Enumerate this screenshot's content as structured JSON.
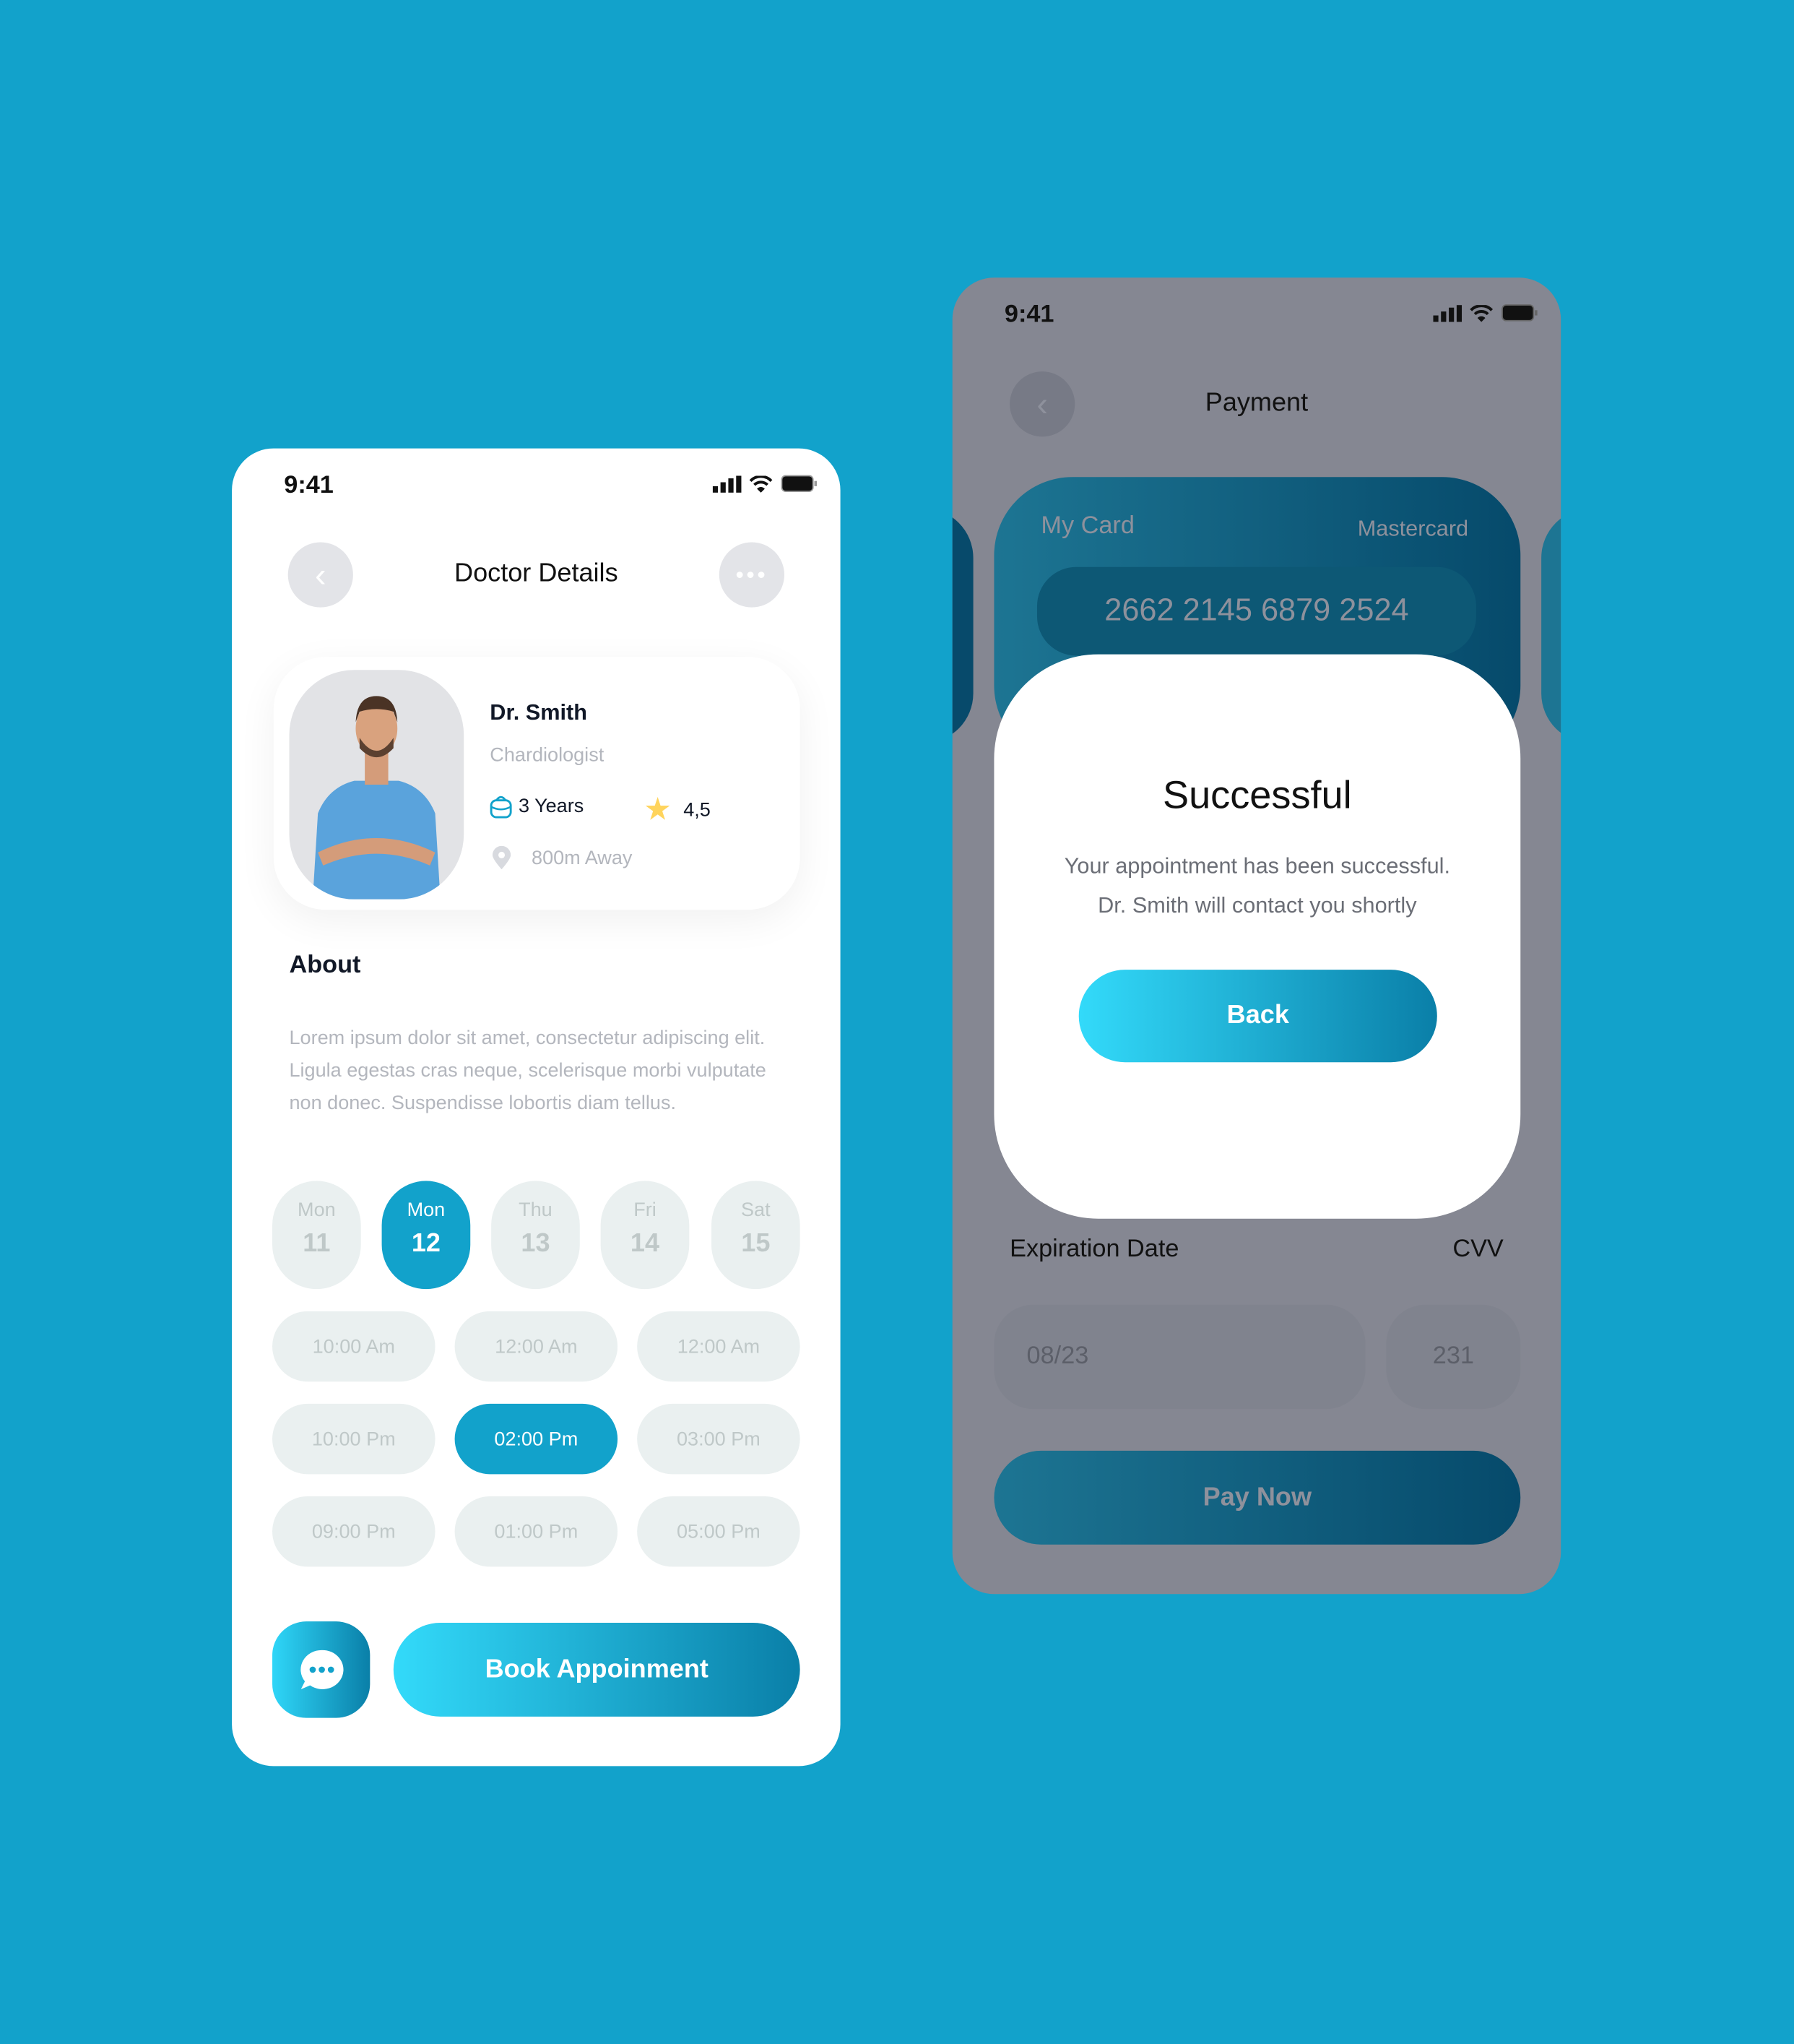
{
  "colors": {
    "background": "#12A2CB",
    "accent": "#12A2CB",
    "star": "#FFD45C",
    "overlay": "#858792"
  },
  "doctor_screen": {
    "status_time": "9:41",
    "title": "Doctor Details",
    "back_icon": "chevron-left-icon",
    "more_icon": "more-dots-icon",
    "doctor": {
      "name": "Dr. Smith",
      "specialty": "Chardiologist",
      "experience": "3 Years",
      "rating": "4,5",
      "distance": "800m Away"
    },
    "about_heading": "About",
    "about_text": "Lorem ipsum dolor sit amet, consectetur adipiscing elit. Ligula egestas cras neque, scelerisque morbi vulputate non donec. Suspendisse lobortis diam tellus.",
    "days": [
      {
        "name": "Mon",
        "date": "11"
      },
      {
        "name": "Mon",
        "date": "12",
        "selected": true
      },
      {
        "name": "Thu",
        "date": "13"
      },
      {
        "name": "Fri",
        "date": "14"
      },
      {
        "name": "Sat",
        "date": "15"
      }
    ],
    "times": [
      "10:00 Am",
      "12:00 Am",
      "12:00 Am",
      "10:00 Pm",
      "02:00 Pm",
      "03:00 Pm",
      "09:00 Pm",
      "01:00 Pm",
      "05:00 Pm"
    ],
    "selected_time": "02:00 Pm",
    "book_label": "Book Appoinment"
  },
  "payment_screen": {
    "status_time": "9:41",
    "title": "Payment",
    "card": {
      "label": "My Card",
      "brand": "Mastercard",
      "number": "2662 2145 6879 2524"
    },
    "expiration_label": "Expiration Date",
    "cvv_label": "CVV",
    "expiration_value": "08/23",
    "cvv_value": "231",
    "pay_label": "Pay Now",
    "modal": {
      "title": "Successful",
      "message_line1": "Your appointment has been successful.",
      "message_line2": "Dr. Smith will contact you shortly",
      "back_label": "Back"
    }
  }
}
